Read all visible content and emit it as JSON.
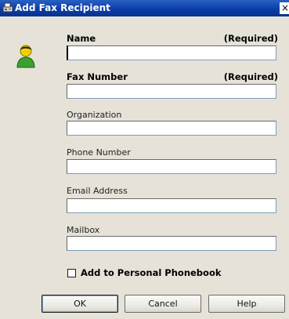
{
  "window": {
    "title": "Add Fax Recipient",
    "close_glyph": "×"
  },
  "icons": {
    "title_icon": "fax-icon",
    "avatar": "user-icon"
  },
  "fields": {
    "name": {
      "label": "Name",
      "required": "(Required)",
      "value": ""
    },
    "fax_number": {
      "label": "Fax Number",
      "required": "(Required)",
      "value": ""
    },
    "organization": {
      "label": "Organization",
      "value": ""
    },
    "phone_number": {
      "label": "Phone Number",
      "value": ""
    },
    "email_address": {
      "label": "Email Address",
      "value": ""
    },
    "mailbox": {
      "label": "Mailbox",
      "value": ""
    }
  },
  "checkbox": {
    "label": "Add to Personal Phonebook",
    "checked": false
  },
  "buttons": {
    "ok": "OK",
    "cancel": "Cancel",
    "help": "Help"
  },
  "colors": {
    "titlebar": "#0a3ea8",
    "dialog_bg": "#e6e2d8",
    "input_border": "#7f9db9"
  }
}
